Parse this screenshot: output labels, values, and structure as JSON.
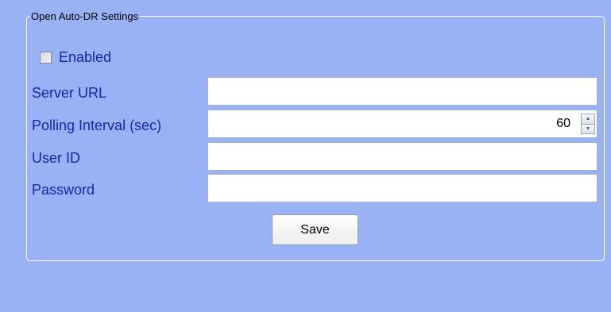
{
  "group": {
    "title": "Open Auto-DR Settings"
  },
  "enabled": {
    "label": "Enabled",
    "checked": false
  },
  "fields": {
    "server_url": {
      "label": "Server URL",
      "value": ""
    },
    "polling_interval": {
      "label": "Polling Interval (sec)",
      "value": "60"
    },
    "user_id": {
      "label": "User ID",
      "value": ""
    },
    "password": {
      "label": "Password",
      "value": ""
    }
  },
  "save_label": "Save",
  "colors": {
    "background": "#99b1f5",
    "label_text": "#1a25a8",
    "group_border": "#ffffff"
  },
  "icons": {
    "spin_up": "triangle-up-icon",
    "spin_down": "triangle-down-icon"
  }
}
